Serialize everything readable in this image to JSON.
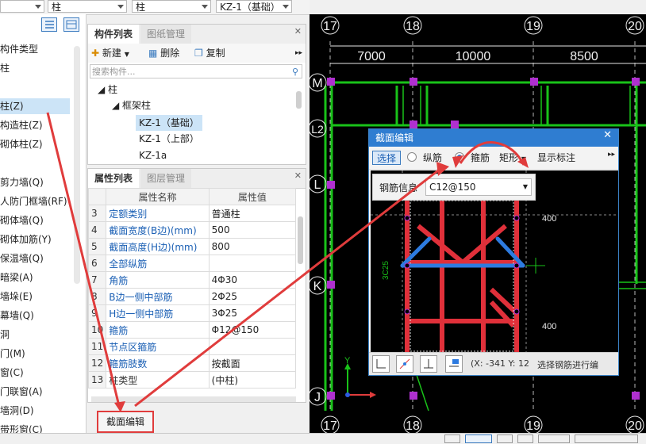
{
  "top_combos": {
    "floor_type": "",
    "category": "柱",
    "component": "KZ-1（基础）"
  },
  "left_tree": {
    "items": [
      {
        "label": "构件类型",
        "selected": false
      },
      {
        "label": "柱",
        "selected": false
      },
      {
        "label": "柱(Z)",
        "selected": true
      },
      {
        "label": "构造柱(Z)",
        "selected": false
      },
      {
        "label": "砌体柱(Z)",
        "selected": false
      },
      {
        "label": "剪力墙(Q)",
        "selected": false
      },
      {
        "label": "人防门框墙(RF)",
        "selected": false
      },
      {
        "label": "砌体墙(Q)",
        "selected": false
      },
      {
        "label": "砌体加筋(Y)",
        "selected": false
      },
      {
        "label": "保温墙(Q)",
        "selected": false
      },
      {
        "label": "暗梁(A)",
        "selected": false
      },
      {
        "label": "墙垛(E)",
        "selected": false
      },
      {
        "label": "幕墙(Q)",
        "selected": false
      },
      {
        "label": "洞",
        "selected": false
      },
      {
        "label": "门(M)",
        "selected": false
      },
      {
        "label": "窗(C)",
        "selected": false
      },
      {
        "label": "门联窗(A)",
        "selected": false
      },
      {
        "label": "墙洞(D)",
        "selected": false
      },
      {
        "label": "带形窗(C)",
        "selected": false
      }
    ]
  },
  "component_list": {
    "tab_active": "构件列表",
    "tab_inactive": "图纸管理",
    "toolbar": {
      "new": "新建",
      "delete": "删除",
      "copy": "复制"
    },
    "search_placeholder": "搜索构件...",
    "tree": {
      "root": "柱",
      "group": "框架柱",
      "items": [
        "KZ-1（基础）",
        "KZ-1（上部）",
        "KZ-1a"
      ]
    }
  },
  "properties": {
    "tab_active": "属性列表",
    "tab_inactive": "图层管理",
    "headers": {
      "name": "属性名称",
      "value": "属性值"
    },
    "rows": [
      {
        "num": "3",
        "name": "定额类别",
        "value": "普通柱",
        "link": true
      },
      {
        "num": "4",
        "name": "截面宽度(B边)(mm)",
        "value": "500",
        "link": true
      },
      {
        "num": "5",
        "name": "截面高度(H边)(mm)",
        "value": "800",
        "link": true
      },
      {
        "num": "6",
        "name": "全部纵筋",
        "value": "",
        "link": true
      },
      {
        "num": "7",
        "name": "角筋",
        "value": "4Φ30",
        "link": true
      },
      {
        "num": "8",
        "name": "B边一侧中部筋",
        "value": "2Φ25",
        "link": true
      },
      {
        "num": "9",
        "name": "H边一侧中部筋",
        "value": "3Φ25",
        "link": true
      },
      {
        "num": "10",
        "name": "箍筋",
        "value": "Φ12@150",
        "link": true
      },
      {
        "num": "11",
        "name": "节点区箍筋",
        "value": "",
        "link": true
      },
      {
        "num": "12",
        "name": "箍筋肢数",
        "value": "按截面",
        "link": true
      },
      {
        "num": "13",
        "name": "柱类型",
        "value": "(中柱)",
        "link": false
      }
    ]
  },
  "section_edit_button": "截面编辑",
  "drawing": {
    "axes_top": [
      "17",
      "18",
      "19",
      "20"
    ],
    "axes_bottom": [
      "17",
      "18",
      "19",
      "20"
    ],
    "dimensions": [
      "7000",
      "10000",
      "8500"
    ],
    "axes_left": [
      "M",
      "L2",
      "L",
      "K",
      "J"
    ]
  },
  "dialog": {
    "title": "截面编辑",
    "select_btn": "选择",
    "radio_longitudinal": "纵筋",
    "radio_stirrup": "箍筋",
    "shape": "矩形",
    "show_dim": "显示标注",
    "rebar_info_label": "钢筋信息",
    "rebar_info_value": "C12@150",
    "dim_labels": [
      "400",
      "400"
    ],
    "side_label": "3C25",
    "status": "(X: -341 Y: 12",
    "hint": "选择钢筋进行编"
  },
  "colors": {
    "accent": "#2f7dd1",
    "annotation": "#e03c3c",
    "rebar_red": "#e0303a",
    "rebar_blue": "#2d7be0",
    "grid_green": "#19c219"
  }
}
